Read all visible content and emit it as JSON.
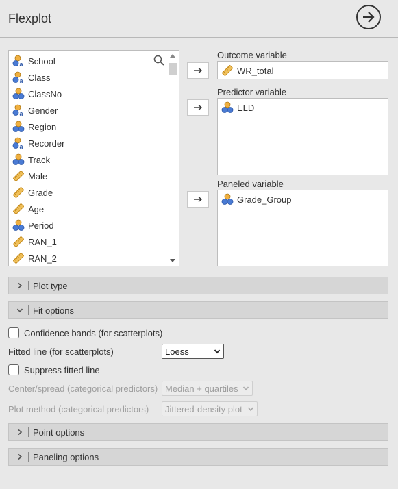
{
  "header": {
    "title": "Flexplot"
  },
  "variables": [
    {
      "label": "School",
      "type": "nominal-text"
    },
    {
      "label": "Class",
      "type": "nominal-text"
    },
    {
      "label": "ClassNo",
      "type": "nominal"
    },
    {
      "label": "Gender",
      "type": "nominal-text"
    },
    {
      "label": "Region",
      "type": "nominal"
    },
    {
      "label": "Recorder",
      "type": "nominal-text"
    },
    {
      "label": "Track",
      "type": "nominal"
    },
    {
      "label": "Male",
      "type": "scale"
    },
    {
      "label": "Grade",
      "type": "scale"
    },
    {
      "label": "Age",
      "type": "scale"
    },
    {
      "label": "Period",
      "type": "nominal"
    },
    {
      "label": "RAN_1",
      "type": "scale"
    },
    {
      "label": "RAN_2",
      "type": "scale"
    }
  ],
  "outcome": {
    "label": "Outcome variable",
    "value": "WR_total",
    "type": "scale"
  },
  "predictor": {
    "label": "Predictor variable",
    "value": "ELD",
    "type": "nominal"
  },
  "paneled": {
    "label": "Paneled variable",
    "value": "Grade_Group",
    "type": "nominal"
  },
  "sections": {
    "plot_type": "Plot type",
    "fit_options": "Fit options",
    "point_options": "Point options",
    "paneling_options": "Paneling options"
  },
  "fit": {
    "confidence_bands": "Confidence bands (for scatterplots)",
    "fitted_line_label": "Fitted line (for scatterplots)",
    "fitted_line_value": "Loess",
    "suppress": "Suppress fitted line",
    "center_label": "Center/spread (categorical predictors)",
    "center_value": "Median + quartiles",
    "plot_method_label": "Plot method (categorical predictors)",
    "plot_method_value": "Jittered-density plot"
  },
  "colors": {
    "ruler": "#e8b84a",
    "nominal_blue": "#4a7bd4",
    "nominal_orange": "#e8a838"
  }
}
